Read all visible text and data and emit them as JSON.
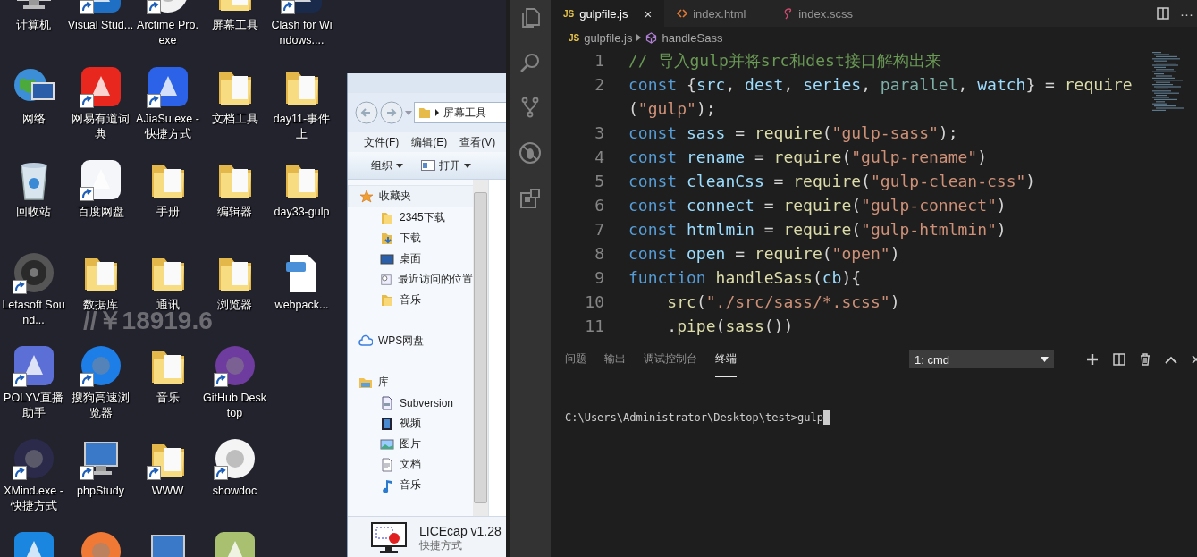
{
  "desktop": {
    "rows": [
      [
        {
          "label": "计算机",
          "kind": "computer",
          "shortcut": false
        },
        {
          "label": "Visual Stud...",
          "kind": "app",
          "color": "#1f6fc5",
          "shortcut": true
        },
        {
          "label": "Arctime Pro.exe",
          "kind": "round",
          "color": "#f2f2f2",
          "shortcut": true
        },
        {
          "label": "屏幕工具",
          "kind": "folder",
          "shortcut": false
        },
        {
          "label": "Clash for Windows....",
          "kind": "app",
          "color": "#1a2a4a",
          "shortcut": true
        }
      ],
      [
        {
          "label": "网络",
          "kind": "globe",
          "shortcut": false
        },
        {
          "label": "网易有道词典",
          "kind": "app",
          "color": "#e8281e",
          "shortcut": true
        },
        {
          "label": "AJiaSu.exe - 快捷方式",
          "kind": "app",
          "color": "#2b62e8",
          "shortcut": true
        },
        {
          "label": "文档工具",
          "kind": "folder",
          "shortcut": false
        },
        {
          "label": "day11-事件上",
          "kind": "folder",
          "shortcut": false
        }
      ],
      [
        {
          "label": "回收站",
          "kind": "recycle",
          "shortcut": false
        },
        {
          "label": "百度网盘",
          "kind": "app",
          "color": "#f4f6fa",
          "shortcut": true
        },
        {
          "label": "手册",
          "kind": "folder",
          "shortcut": false
        },
        {
          "label": "编辑器",
          "kind": "folder",
          "shortcut": false
        },
        {
          "label": "day33-gulp",
          "kind": "folder",
          "shortcut": false
        }
      ],
      [
        {
          "label": "Letasoft Sound...",
          "kind": "speaker",
          "shortcut": true
        },
        {
          "label": "数据库",
          "kind": "folder",
          "shortcut": false
        },
        {
          "label": "通讯",
          "kind": "folder",
          "shortcut": false
        },
        {
          "label": "浏览器",
          "kind": "folder",
          "shortcut": false
        },
        {
          "label": "webpack...",
          "kind": "gif",
          "shortcut": false
        }
      ],
      [
        {
          "label": "POLYV直播助手",
          "kind": "app",
          "color": "#5b6fd6",
          "shortcut": true
        },
        {
          "label": "搜狗高速浏览器",
          "kind": "round",
          "color": "#1e7ee8",
          "shortcut": true
        },
        {
          "label": "音乐",
          "kind": "folder",
          "shortcut": false
        },
        {
          "label": "GitHub Desktop",
          "kind": "round",
          "color": "#6e3b9e",
          "shortcut": true
        }
      ],
      [
        {
          "label": "XMind.exe - 快捷方式",
          "kind": "round",
          "color": "#2b2a4a",
          "shortcut": true
        },
        {
          "label": "phpStudy",
          "kind": "computer",
          "shortcut": true
        },
        {
          "label": "WWW",
          "kind": "folder",
          "shortcut": true
        },
        {
          "label": "showdoc",
          "kind": "round",
          "color": "#f4f4f4",
          "shortcut": true
        }
      ],
      [
        {
          "kind": "app",
          "color": "#1b86e0",
          "shortcut": false
        },
        {
          "kind": "round",
          "color": "#f07a35",
          "shortcut": false
        },
        {
          "kind": "computer",
          "shortcut": false
        },
        {
          "kind": "app",
          "color": "#a8c070",
          "shortcut": false
        }
      ]
    ],
    "overlay_text": "//￥18919.6"
  },
  "explorer": {
    "address": "屏幕工具",
    "menu": [
      "文件(F)",
      "编辑(E)",
      "查看(V)"
    ],
    "toolbar": [
      "组织",
      "打开"
    ],
    "nav": [
      {
        "label": "收藏夹",
        "kind": "star",
        "selected": true,
        "children": [
          {
            "label": "2345下载",
            "kind": "folder",
            "selected": false
          },
          {
            "label": "下载",
            "kind": "download",
            "selected": false
          },
          {
            "label": "桌面",
            "kind": "desktop",
            "selected": false
          },
          {
            "label": "最近访问的位置",
            "kind": "recent",
            "selected": false
          },
          {
            "label": "音乐",
            "kind": "folder",
            "selected": false
          }
        ]
      },
      {
        "label": "WPS网盘",
        "kind": "cloud",
        "selected": false
      },
      {
        "label": "库",
        "kind": "library",
        "selected": false,
        "children": [
          {
            "label": "Subversion",
            "kind": "doc",
            "selected": false
          },
          {
            "label": "视频",
            "kind": "video",
            "selected": false
          },
          {
            "label": "图片",
            "kind": "picture",
            "selected": false
          },
          {
            "label": "文档",
            "kind": "document",
            "selected": false
          },
          {
            "label": "音乐",
            "kind": "music",
            "selected": false
          }
        ]
      }
    ],
    "details": {
      "name": "LICEcap v1.28",
      "type": "快捷方式"
    }
  },
  "editor": {
    "tabs": [
      {
        "label": "gulpfile.js",
        "kind": "js",
        "badge": "JS",
        "selected": true,
        "close": "×"
      },
      {
        "label": "index.html",
        "kind": "html",
        "selected": false
      },
      {
        "label": "index.scss",
        "kind": "scss",
        "selected": false
      }
    ],
    "more": "···",
    "breadcrumb": {
      "badge": "JS",
      "file": "gulpfile.js",
      "symbol": "handleSass"
    },
    "lines": [
      {
        "number": "1",
        "rows": [
          [
            {
              "text": "// 导入gulp并将src和dest接口解构出来",
              "kind": "comment"
            }
          ]
        ]
      },
      {
        "number": "2",
        "rows": [
          [
            {
              "text": "const",
              "kind": "kw"
            },
            {
              "text": " {",
              "kind": "p"
            },
            {
              "text": "src",
              "kind": "var"
            },
            {
              "text": ", ",
              "kind": "p"
            },
            {
              "text": "dest",
              "kind": "var"
            },
            {
              "text": ", ",
              "kind": "p"
            },
            {
              "text": "series",
              "kind": "var"
            },
            {
              "text": ", ",
              "kind": "p"
            },
            {
              "text": "parallel",
              "kind": "type"
            },
            {
              "text": ", ",
              "kind": "p"
            },
            {
              "text": "watch",
              "kind": "var"
            },
            {
              "text": "} = ",
              "kind": "p"
            },
            {
              "text": "require",
              "kind": "fn"
            }
          ],
          [
            {
              "text": "(",
              "kind": "p"
            },
            {
              "text": "\"gulp\"",
              "kind": "str"
            },
            {
              "text": ");",
              "kind": "p"
            }
          ]
        ]
      },
      {
        "number": "3",
        "rows": [
          [
            {
              "text": "const",
              "kind": "kw"
            },
            {
              "text": " ",
              "kind": "p"
            },
            {
              "text": "sass",
              "kind": "var"
            },
            {
              "text": " = ",
              "kind": "p"
            },
            {
              "text": "require",
              "kind": "fn"
            },
            {
              "text": "(",
              "kind": "p"
            },
            {
              "text": "\"gulp-sass\"",
              "kind": "str"
            },
            {
              "text": ");",
              "kind": "p"
            }
          ]
        ]
      },
      {
        "number": "4",
        "rows": [
          [
            {
              "text": "const",
              "kind": "kw"
            },
            {
              "text": " ",
              "kind": "p"
            },
            {
              "text": "rename",
              "kind": "var"
            },
            {
              "text": " = ",
              "kind": "p"
            },
            {
              "text": "require",
              "kind": "fn"
            },
            {
              "text": "(",
              "kind": "p"
            },
            {
              "text": "\"gulp-rename\"",
              "kind": "str"
            },
            {
              "text": ")",
              "kind": "p"
            }
          ]
        ]
      },
      {
        "number": "5",
        "rows": [
          [
            {
              "text": "const",
              "kind": "kw"
            },
            {
              "text": " ",
              "kind": "p"
            },
            {
              "text": "cleanCss",
              "kind": "var"
            },
            {
              "text": " = ",
              "kind": "p"
            },
            {
              "text": "require",
              "kind": "fn"
            },
            {
              "text": "(",
              "kind": "p"
            },
            {
              "text": "\"gulp-clean-css\"",
              "kind": "str"
            },
            {
              "text": ")",
              "kind": "p"
            }
          ]
        ]
      },
      {
        "number": "6",
        "rows": [
          [
            {
              "text": "const",
              "kind": "kw"
            },
            {
              "text": " ",
              "kind": "p"
            },
            {
              "text": "connect",
              "kind": "var"
            },
            {
              "text": " = ",
              "kind": "p"
            },
            {
              "text": "require",
              "kind": "fn"
            },
            {
              "text": "(",
              "kind": "p"
            },
            {
              "text": "\"gulp-connect\"",
              "kind": "str"
            },
            {
              "text": ")",
              "kind": "p"
            }
          ]
        ]
      },
      {
        "number": "7",
        "rows": [
          [
            {
              "text": "const",
              "kind": "kw"
            },
            {
              "text": " ",
              "kind": "p"
            },
            {
              "text": "htmlmin",
              "kind": "var"
            },
            {
              "text": " = ",
              "kind": "p"
            },
            {
              "text": "require",
              "kind": "fn"
            },
            {
              "text": "(",
              "kind": "p"
            },
            {
              "text": "\"gulp-htmlmin\"",
              "kind": "str"
            },
            {
              "text": ")",
              "kind": "p"
            }
          ]
        ]
      },
      {
        "number": "8",
        "rows": [
          [
            {
              "text": "const",
              "kind": "kw"
            },
            {
              "text": " ",
              "kind": "p"
            },
            {
              "text": "open",
              "kind": "var"
            },
            {
              "text": " = ",
              "kind": "p"
            },
            {
              "text": "require",
              "kind": "fn"
            },
            {
              "text": "(",
              "kind": "p"
            },
            {
              "text": "\"open\"",
              "kind": "str"
            },
            {
              "text": ")",
              "kind": "p"
            }
          ]
        ]
      },
      {
        "number": "9",
        "rows": [
          [
            {
              "text": "function",
              "kind": "kw"
            },
            {
              "text": " ",
              "kind": "p"
            },
            {
              "text": "handleSass",
              "kind": "fn"
            },
            {
              "text": "(",
              "kind": "p"
            },
            {
              "text": "cb",
              "kind": "var"
            },
            {
              "text": "){",
              "kind": "p"
            }
          ]
        ]
      },
      {
        "number": "10",
        "rows": [
          [
            {
              "text": "    ",
              "kind": "p"
            },
            {
              "text": "src",
              "kind": "fn"
            },
            {
              "text": "(",
              "kind": "p"
            },
            {
              "text": "\"./src/sass/*.scss\"",
              "kind": "str"
            },
            {
              "text": ")",
              "kind": "p"
            }
          ]
        ]
      },
      {
        "number": "11",
        "rows": [
          [
            {
              "text": "    .",
              "kind": "p"
            },
            {
              "text": "pipe",
              "kind": "fn"
            },
            {
              "text": "(",
              "kind": "p"
            },
            {
              "text": "sass",
              "kind": "fn"
            },
            {
              "text": "())",
              "kind": "p"
            }
          ]
        ]
      }
    ],
    "panel": {
      "tabs": [
        {
          "label": "问题",
          "selected": false
        },
        {
          "label": "输出",
          "selected": false
        },
        {
          "label": "调试控制台",
          "selected": false
        },
        {
          "label": "终端",
          "selected": true
        }
      ],
      "terminal_select": "1: cmd",
      "prompt": "C:\\Users\\Administrator\\Desktop\\test>gulp"
    }
  }
}
